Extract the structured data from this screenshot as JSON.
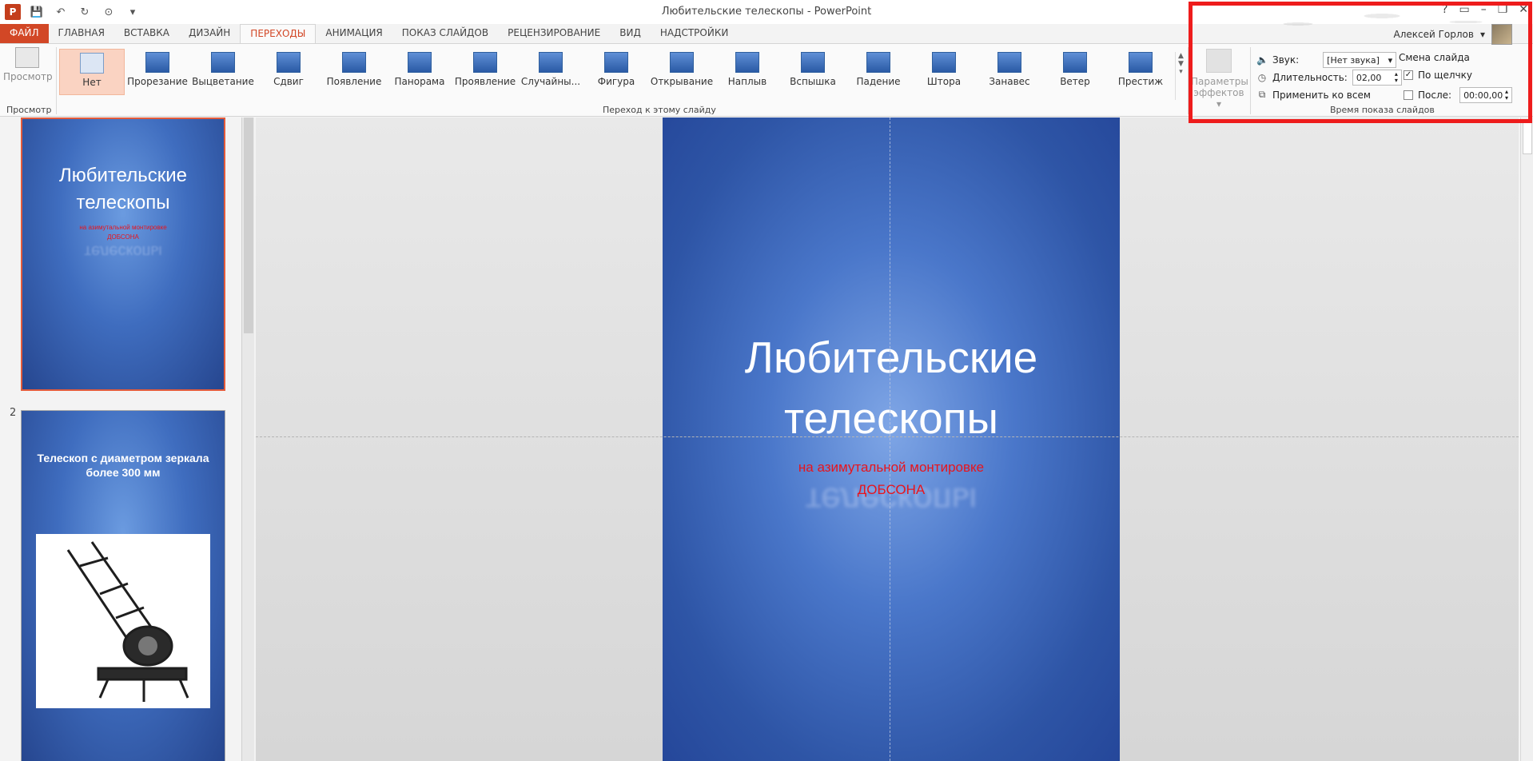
{
  "window": {
    "title": "Любительские телескопы - PowerPoint",
    "logo_letter": "P",
    "user_name": "Алексей Горлов",
    "controls": [
      "?",
      "▭",
      "–",
      "❐",
      "✕"
    ]
  },
  "tabs": [
    {
      "label": "ФАЙЛ"
    },
    {
      "label": "ГЛАВНАЯ"
    },
    {
      "label": "ВСТАВКА"
    },
    {
      "label": "ДИЗАЙН"
    },
    {
      "label": "ПЕРЕХОДЫ"
    },
    {
      "label": "АНИМАЦИЯ"
    },
    {
      "label": "ПОКАЗ СЛАЙДОВ"
    },
    {
      "label": "РЕЦЕНЗИРОВАНИЕ"
    },
    {
      "label": "ВИД"
    },
    {
      "label": "НАДСТРОЙКИ"
    }
  ],
  "ribbon": {
    "preview": {
      "label": "Просмотр",
      "group": "Просмотр"
    },
    "transitions_group": "Переход к этому слайду",
    "transitions": [
      {
        "label": "Нет"
      },
      {
        "label": "Прорезание"
      },
      {
        "label": "Выцветание"
      },
      {
        "label": "Сдвиг"
      },
      {
        "label": "Появление"
      },
      {
        "label": "Панорама"
      },
      {
        "label": "Проявление"
      },
      {
        "label": "Случайны..."
      },
      {
        "label": "Фигура"
      },
      {
        "label": "Открывание"
      },
      {
        "label": "Наплыв"
      },
      {
        "label": "Вспышка"
      },
      {
        "label": "Падение"
      },
      {
        "label": "Штора"
      },
      {
        "label": "Занавес"
      },
      {
        "label": "Ветер"
      },
      {
        "label": "Престиж"
      }
    ],
    "effects": {
      "line1": "Параметры",
      "line2": "эффектов"
    },
    "timing": {
      "group": "Время показа слайдов",
      "sound_label": "Звук:",
      "sound_value": "[Нет звука]",
      "duration_label": "Длительность:",
      "duration_value": "02,00",
      "apply_all": "Применить ко всем",
      "advance_header": "Смена слайда",
      "on_click": "По щелчку",
      "on_click_checked": true,
      "after_label": "После:",
      "after_checked": false,
      "after_value": "00:00,00"
    }
  },
  "slides": [
    {
      "number": "",
      "title_line1": "Любительские",
      "title_line2": "телескопы",
      "sub_line1": "на  азимутальной монтировке",
      "sub_line2": "ДОБСОНА"
    },
    {
      "number": "2",
      "title_line1": "Телескоп с диаметром зеркала",
      "title_line2": "более 300 мм"
    }
  ],
  "main_slide": {
    "title_line1": "Любительские",
    "title_line2": "телескопы",
    "sub_line1": "на  азимутальной монтировке",
    "sub_line2": "ДОБСОНА"
  },
  "colors": {
    "file_tab": "#d24726",
    "active_tab_text": "#d24726",
    "highlight_frame": "#ee1c1c",
    "subtitle_red": "#e8141c",
    "slide_blue": "#3f6dbf"
  }
}
